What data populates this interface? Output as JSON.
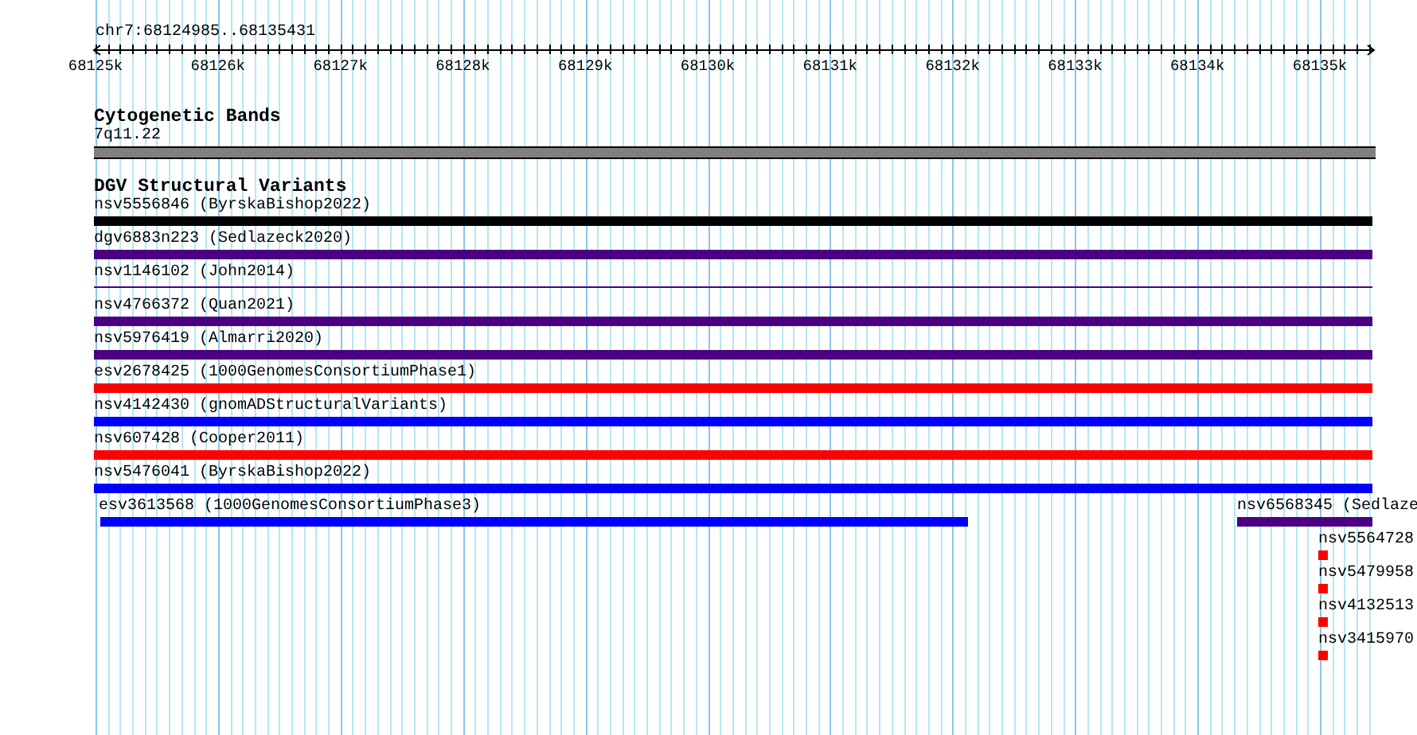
{
  "ruler": {
    "location": "chr7:68124985..68135431",
    "ticks": [
      "68125k",
      "68126k",
      "68127k",
      "68128k",
      "68129k",
      "68130k",
      "68131k",
      "68132k",
      "68133k",
      "68134k",
      "68135k"
    ]
  },
  "cytogenetic_bands": {
    "title": "Cytogenetic Bands",
    "band": {
      "label": "7q11.22",
      "color": "#808080"
    }
  },
  "structural_variants": {
    "title": "DGV Structural Variants",
    "rows": [
      {
        "features": [
          {
            "label": "nsv5556846 (ByrskaBishop2022)",
            "color": "#000000",
            "kind": "bar"
          }
        ]
      },
      {
        "features": [
          {
            "label": "dgv6883n223 (Sedlazeck2020)",
            "color": "#4b0082",
            "kind": "bar"
          }
        ]
      },
      {
        "features": [
          {
            "label": "nsv1146102 (John2014)",
            "color": "#4b0082",
            "kind": "line"
          }
        ]
      },
      {
        "features": [
          {
            "label": "nsv4766372 (Quan2021)",
            "color": "#4b0082",
            "kind": "bar"
          }
        ]
      },
      {
        "features": [
          {
            "label": "nsv5976419 (Almarri2020)",
            "color": "#4b0082",
            "kind": "bar"
          }
        ]
      },
      {
        "features": [
          {
            "label": "esv2678425 (1000GenomesConsortiumPhase1)",
            "color": "#ff0000",
            "kind": "bar"
          }
        ]
      },
      {
        "features": [
          {
            "label": "nsv4142430 (gnomADStructuralVariants)",
            "color": "#0000ff",
            "kind": "bar"
          }
        ]
      },
      {
        "features": [
          {
            "label": "nsv607428 (Cooper2011)",
            "color": "#ff0000",
            "kind": "bar"
          }
        ]
      },
      {
        "features": [
          {
            "label": "nsv5476041 (ByrskaBishop2022)",
            "color": "#0000ff",
            "kind": "bar"
          }
        ]
      },
      {
        "features": [
          {
            "label": "esv3613568 (1000GenomesConsortiumPhase3)",
            "color": "#0000ff",
            "kind": "bar"
          },
          {
            "label": "nsv6568345 (Sedlaze",
            "color": "#4b0082",
            "kind": "bar"
          }
        ]
      },
      {
        "features": [
          {
            "label": "nsv5564728",
            "color": "#ff0000",
            "kind": "bar"
          }
        ]
      },
      {
        "features": [
          {
            "label": "nsv5479958",
            "color": "#ff0000",
            "kind": "bar"
          }
        ]
      },
      {
        "features": [
          {
            "label": "nsv4132513",
            "color": "#ff0000",
            "kind": "bar"
          }
        ]
      },
      {
        "features": [
          {
            "label": "nsv3415970",
            "color": "#ff0000",
            "kind": "bar"
          }
        ]
      }
    ]
  }
}
